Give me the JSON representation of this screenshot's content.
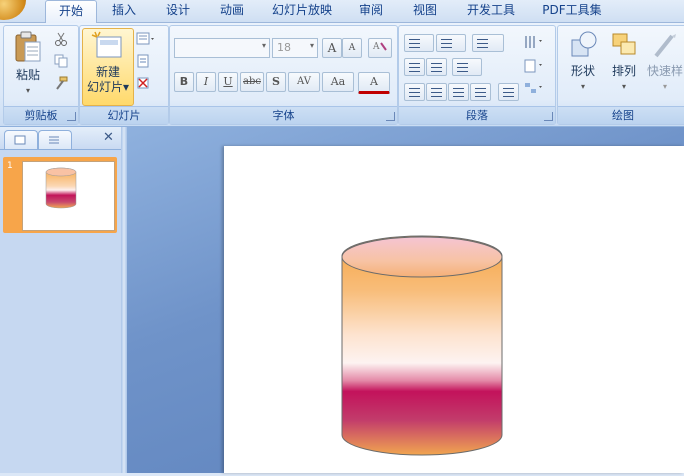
{
  "tabs": [
    {
      "label": "开始",
      "active": true
    },
    {
      "label": "插入"
    },
    {
      "label": "设计"
    },
    {
      "label": "动画"
    },
    {
      "label": "幻灯片放映"
    },
    {
      "label": "审阅"
    },
    {
      "label": "视图"
    },
    {
      "label": "开发工具"
    },
    {
      "label": "PDF工具集"
    }
  ],
  "ribbon": {
    "clipboard": {
      "paste_label": "粘贴",
      "group_label": "剪贴板"
    },
    "slides": {
      "new_slide_line1": "新建",
      "new_slide_line2": "幻灯片",
      "group_label": "幻灯片"
    },
    "font": {
      "font_name": "",
      "font_size": "18",
      "bold": "B",
      "italic": "I",
      "underline": "U",
      "strike": "abc",
      "shadow": "S",
      "spacing": "AV",
      "case": "Aa",
      "color": "A",
      "grow": "A",
      "shrink": "A",
      "group_label": "字体"
    },
    "paragraph": {
      "group_label": "段落"
    },
    "drawing": {
      "shapes_label": "形状",
      "arrange_label": "排列",
      "quickstyle_label": "快速样",
      "group_label": "绘图"
    }
  },
  "slide_panel": {
    "slide_number": "1",
    "close_glyph": "✕"
  },
  "colors": {
    "accent_orange": "#f7a54a",
    "magenta": "#c21a62",
    "ribbon_text": "#15428b"
  }
}
